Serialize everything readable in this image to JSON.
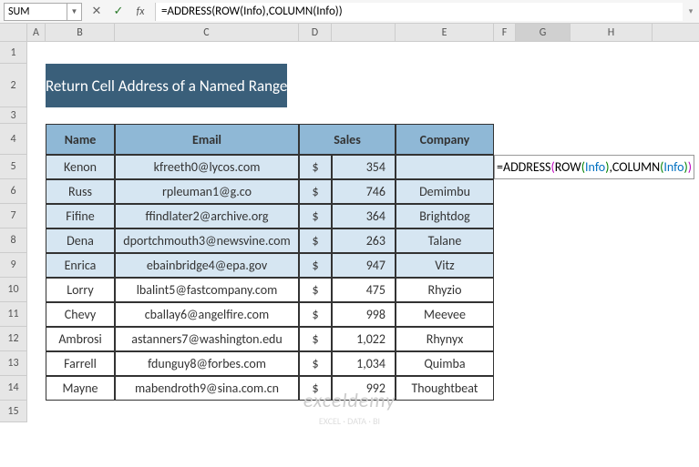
{
  "formulaBar": {
    "nameBox": "SUM",
    "formula": "=ADDRESS(ROW(Info),COLUMN(Info))"
  },
  "columns": [
    "A",
    "B",
    "C",
    "D",
    "",
    "E",
    "F",
    "G",
    "H"
  ],
  "rowNums": [
    "1",
    "2",
    "3",
    "4",
    "5",
    "6",
    "7",
    "8",
    "9",
    "10",
    "11",
    "12",
    "13",
    "14",
    "15"
  ],
  "title": "Return Cell Address of a Named Range",
  "headers": {
    "name": "Name",
    "email": "Email",
    "sales": "Sales",
    "company": "Company"
  },
  "chart_data": {
    "type": "table",
    "columns": [
      "Name",
      "Email",
      "Sales",
      "Company"
    ],
    "rows": [
      {
        "name": "Kenon",
        "email": "kfreeth0@lycos.com",
        "sales": 354,
        "company": ""
      },
      {
        "name": "Russ",
        "email": "rpleuman1@g.co",
        "sales": 746,
        "company": "Demimbu"
      },
      {
        "name": "Fifine",
        "email": "ffindlater2@archive.org",
        "sales": 364,
        "company": "Brightdog"
      },
      {
        "name": "Dena",
        "email": "dportchmouth3@newsvine.com",
        "sales": 263,
        "company": "Talane"
      },
      {
        "name": "Enrica",
        "email": "ebainbridge4@epa.gov",
        "sales": 947,
        "company": "Vitz"
      },
      {
        "name": "Lorry",
        "email": "lbalint5@fastcompany.com",
        "sales": 475,
        "company": "Rhyzio"
      },
      {
        "name": "Chevy",
        "email": "cballay6@angelfire.com",
        "sales": 998,
        "company": "Meevee"
      },
      {
        "name": "Ambrosi",
        "email": "astanners7@washington.edu",
        "sales": "1,022",
        "company": "Rhynyx"
      },
      {
        "name": "Farrell",
        "email": "fdunguy8@forbes.com",
        "sales": "1,034",
        "company": "Quimba"
      },
      {
        "name": "Mayne",
        "email": "mabendroth9@sina.com.cn",
        "sales": 992,
        "company": "Thoughtbeat"
      }
    ]
  },
  "currency": "$",
  "overlay": {
    "eq": "=",
    "fn1": "ADDRESS",
    "po1": "(",
    "fn2": "ROW",
    "po2": "(",
    "info": "Info",
    "pc2": ")",
    "comma": ",",
    "fn3": "COLUMN",
    "po3": "(",
    "pc3": ")",
    "pc1": ")"
  },
  "watermark": "exceldemy",
  "watermark_sub": "EXCEL · DATA · BI"
}
